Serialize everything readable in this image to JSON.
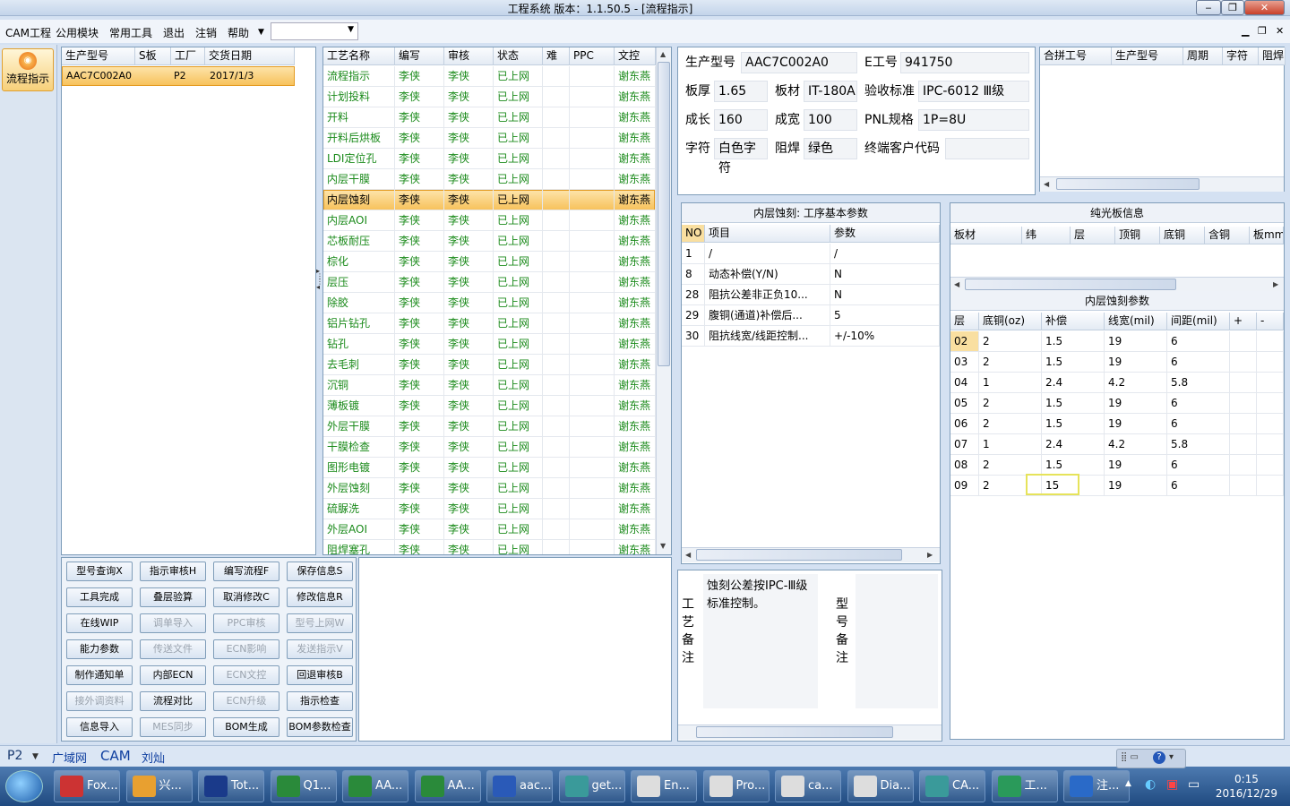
{
  "window": {
    "title": "工程系统   版本：1.1.50.5 - [流程指示]"
  },
  "menu": {
    "items": [
      "CAM工程",
      "公用模块",
      "常用工具",
      "退出",
      "注销",
      "帮助"
    ]
  },
  "nav": {
    "flow_label": "流程指示"
  },
  "orders": {
    "headers": [
      "生产型号",
      "S板",
      "工厂",
      "交货日期"
    ],
    "rows": [
      [
        "AAC7C002A0",
        "",
        "P2",
        "2017/1/3"
      ]
    ]
  },
  "process": {
    "headers": [
      "工艺名称",
      "编写",
      "审核",
      "状态",
      "难",
      "PPC",
      "文控"
    ],
    "rows": [
      [
        "流程指示",
        "李侠",
        "李侠",
        "已上网",
        "",
        "",
        "谢东燕"
      ],
      [
        "计划投料",
        "李侠",
        "李侠",
        "已上网",
        "",
        "",
        "谢东燕"
      ],
      [
        "开料",
        "李侠",
        "李侠",
        "已上网",
        "",
        "",
        "谢东燕"
      ],
      [
        "开料后烘板",
        "李侠",
        "李侠",
        "已上网",
        "",
        "",
        "谢东燕"
      ],
      [
        "LDI定位孔",
        "李侠",
        "李侠",
        "已上网",
        "",
        "",
        "谢东燕"
      ],
      [
        "内层干膜",
        "李侠",
        "李侠",
        "已上网",
        "",
        "",
        "谢东燕"
      ],
      [
        "内层蚀刻",
        "李侠",
        "李侠",
        "已上网",
        "",
        "",
        "谢东燕"
      ],
      [
        "内层AOI",
        "李侠",
        "李侠",
        "已上网",
        "",
        "",
        "谢东燕"
      ],
      [
        "芯板耐压",
        "李侠",
        "李侠",
        "已上网",
        "",
        "",
        "谢东燕"
      ],
      [
        "棕化",
        "李侠",
        "李侠",
        "已上网",
        "",
        "",
        "谢东燕"
      ],
      [
        "层压",
        "李侠",
        "李侠",
        "已上网",
        "",
        "",
        "谢东燕"
      ],
      [
        "除胶",
        "李侠",
        "李侠",
        "已上网",
        "",
        "",
        "谢东燕"
      ],
      [
        "铝片钻孔",
        "李侠",
        "李侠",
        "已上网",
        "",
        "",
        "谢东燕"
      ],
      [
        "钻孔",
        "李侠",
        "李侠",
        "已上网",
        "",
        "",
        "谢东燕"
      ],
      [
        "去毛刺",
        "李侠",
        "李侠",
        "已上网",
        "",
        "",
        "谢东燕"
      ],
      [
        "沉铜",
        "李侠",
        "李侠",
        "已上网",
        "",
        "",
        "谢东燕"
      ],
      [
        "薄板镀",
        "李侠",
        "李侠",
        "已上网",
        "",
        "",
        "谢东燕"
      ],
      [
        "外层干膜",
        "李侠",
        "李侠",
        "已上网",
        "",
        "",
        "谢东燕"
      ],
      [
        "干膜检查",
        "李侠",
        "李侠",
        "已上网",
        "",
        "",
        "谢东燕"
      ],
      [
        "图形电镀",
        "李侠",
        "李侠",
        "已上网",
        "",
        "",
        "谢东燕"
      ],
      [
        "外层蚀刻",
        "李侠",
        "李侠",
        "已上网",
        "",
        "",
        "谢东燕"
      ],
      [
        "硫脲洗",
        "李侠",
        "李侠",
        "已上网",
        "",
        "",
        "谢东燕"
      ],
      [
        "外层AOI",
        "李侠",
        "李侠",
        "已上网",
        "",
        "",
        "谢东燕"
      ],
      [
        "阻焊塞孔",
        "李侠",
        "李侠",
        "已上网",
        "",
        "",
        "谢东燕"
      ]
    ],
    "selected_index": 6
  },
  "buttons": [
    {
      "label": "型号查询X",
      "enabled": true
    },
    {
      "label": "指示审核H",
      "enabled": true
    },
    {
      "label": "编写流程F",
      "enabled": true
    },
    {
      "label": "保存信息S",
      "enabled": true
    },
    {
      "label": "工具完成",
      "enabled": true
    },
    {
      "label": "叠层验算",
      "enabled": true
    },
    {
      "label": "取消修改C",
      "enabled": true
    },
    {
      "label": "修改信息R",
      "enabled": true
    },
    {
      "label": "在线WIP",
      "enabled": true
    },
    {
      "label": "调单导入",
      "enabled": false
    },
    {
      "label": "PPC审核",
      "enabled": false
    },
    {
      "label": "型号上网W",
      "enabled": false
    },
    {
      "label": "能力参数",
      "enabled": true
    },
    {
      "label": "传送文件",
      "enabled": false
    },
    {
      "label": "ECN影响",
      "enabled": false
    },
    {
      "label": "发送指示V",
      "enabled": false
    },
    {
      "label": "制作通知单",
      "enabled": true
    },
    {
      "label": "内部ECN",
      "enabled": true
    },
    {
      "label": "ECN文控",
      "enabled": false
    },
    {
      "label": "回退审核B",
      "enabled": true
    },
    {
      "label": "接外调资料",
      "enabled": false
    },
    {
      "label": "流程对比",
      "enabled": true
    },
    {
      "label": "ECN升级",
      "enabled": false
    },
    {
      "label": "指示检查",
      "enabled": true
    },
    {
      "label": "信息导入",
      "enabled": true
    },
    {
      "label": "MES同步",
      "enabled": false
    },
    {
      "label": "BOM生成",
      "enabled": true
    },
    {
      "label": "BOM参数检查",
      "enabled": true
    }
  ],
  "info": {
    "prod_model_label": "生产型号",
    "prod_model": "AAC7C002A0",
    "eno_label": "E工号",
    "eno": "941750",
    "thickness_label": "板厚",
    "thickness": "1.65",
    "material_label": "板材",
    "material": "IT-180A",
    "std_label": "验收标准",
    "std": "IPC-6012 Ⅲ级",
    "length_label": "成长",
    "length": "160",
    "width_label": "成宽",
    "width": "100",
    "pnl_label": "PNL规格",
    "pnl": "1P=8U",
    "legend_label": "字符",
    "legend": "白色字符",
    "mask_label": "阻焊",
    "mask": "绿色",
    "customer_label": "终端客户代码",
    "customer": ""
  },
  "merge": {
    "headers": [
      "合拼工号",
      "生产型号",
      "周期",
      "字符",
      "阻焊"
    ]
  },
  "params": {
    "title": "内层蚀刻: 工序基本参数",
    "headers": [
      "NO",
      "项目",
      "参数"
    ],
    "rows": [
      [
        "1",
        "/",
        "/"
      ],
      [
        "8",
        "动态补偿(Y/N)",
        "N"
      ],
      [
        "28",
        "阻抗公差非正负10...",
        "N"
      ],
      [
        "29",
        "腹铜(通道)补偿后...",
        "5"
      ],
      [
        "30",
        "阻抗线宽/线距控制...",
        "+/-10%"
      ]
    ]
  },
  "bare": {
    "title": "纯光板信息",
    "headers": [
      "板材",
      "纬",
      "层",
      "顶铜",
      "底铜",
      "含铜",
      "板mm"
    ]
  },
  "etch": {
    "title": "内层蚀刻参数",
    "headers": [
      "层",
      "底铜(oz)",
      "补偿",
      "线宽(mil)",
      "间距(mil)",
      "+",
      "-"
    ],
    "rows": [
      [
        "02",
        "2",
        "1.5",
        "19",
        "6"
      ],
      [
        "03",
        "2",
        "1.5",
        "19",
        "6"
      ],
      [
        "04",
        "1",
        "2.4",
        "4.2",
        "5.8"
      ],
      [
        "05",
        "2",
        "1.5",
        "19",
        "6"
      ],
      [
        "06",
        "2",
        "1.5",
        "19",
        "6"
      ],
      [
        "07",
        "1",
        "2.4",
        "4.2",
        "5.8"
      ],
      [
        "08",
        "2",
        "1.5",
        "19",
        "6"
      ],
      [
        "09",
        "2",
        "15",
        "19",
        "6"
      ]
    ]
  },
  "notes": {
    "process_label": "工艺备注",
    "process_text": "蚀刻公差按IPC-Ⅲ级标准控制。",
    "model_label": "型号备注",
    "model_text": ""
  },
  "status": {
    "items": [
      "P2",
      "广域网",
      "CAM",
      "刘灿"
    ]
  },
  "taskbar": {
    "items": [
      "Fox...",
      "兴...",
      "Tot...",
      "Q1...",
      "AA...",
      "AA...",
      "aac...",
      "get...",
      "En...",
      "Pro...",
      "ca...",
      "Dia...",
      "CA...",
      "工...",
      "注..."
    ],
    "time": "0:15",
    "date": "2016/12/29"
  }
}
